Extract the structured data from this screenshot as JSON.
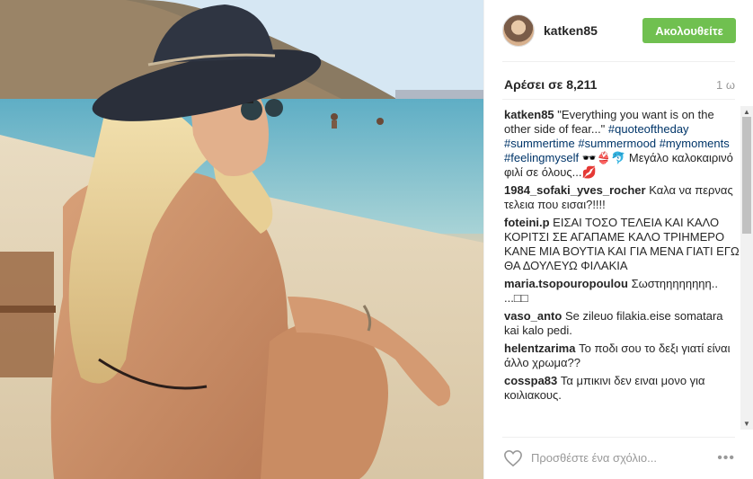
{
  "post": {
    "username": "katken85",
    "follow_label": "Ακολουθείτε",
    "likes_label": "Αρέσει σε 8,211",
    "time_ago": "1 ω"
  },
  "caption": {
    "user": "katken85",
    "text": "\"Everything you want is on the other side of fear...\"",
    "tags": [
      "#quoteoftheday",
      "#summertime",
      "#summermood",
      "#mymoments",
      "#feelingmyself"
    ],
    "emoji_tail": "🕶️👙🐬",
    "line2": "Μεγάλο καλοκαιρινό φιλί σε όλους...💋"
  },
  "comments": [
    {
      "user": "1984_sofaki_yves_rocher",
      "text": "Καλα να περνας τελεια που εισαι?!!!!"
    },
    {
      "user": "foteini.p",
      "text": "ΕΙΣΑΙ ΤΟΣΟ ΤΕΛΕΙΑ ΚΑΙ ΚΑΛΟ ΚΟΡΙΤΣΙ ΣΕ ΑΓΑΠΑΜΕ ΚΑΛΟ ΤΡΙΗΜΕΡΟ ΚΑΝΕ ΜΙΑ ΒΟΥΤΙΑ ΚΑΙ ΓΙΑ ΜΕΝΑ ΓΙΑΤΙ ΕΓΩ ΘΑ ΔΟΥΛΕΥΩ ΦΙΛΑΚΙΑ"
    },
    {
      "user": "maria.tsopouropoulou",
      "text": "Σωστηηηηηηηη.. ...□□"
    },
    {
      "user": "vaso_anto",
      "text": "Se zileuo filakia.eise somatara kai kalo pedi."
    },
    {
      "user": "helentzarima",
      "text": "Το ποδι σου το δεξι γιατί είναι άλλο χρωμα??"
    },
    {
      "user": "cosspa83",
      "text": "Τα μπικινι δεν ειναι μονο για κοιλιακους."
    }
  ],
  "footer": {
    "placeholder": "Προσθέστε ένα σχόλιο...",
    "more": "•••"
  },
  "colors": {
    "follow_bg": "#70c050",
    "hashtag": "#003569"
  }
}
